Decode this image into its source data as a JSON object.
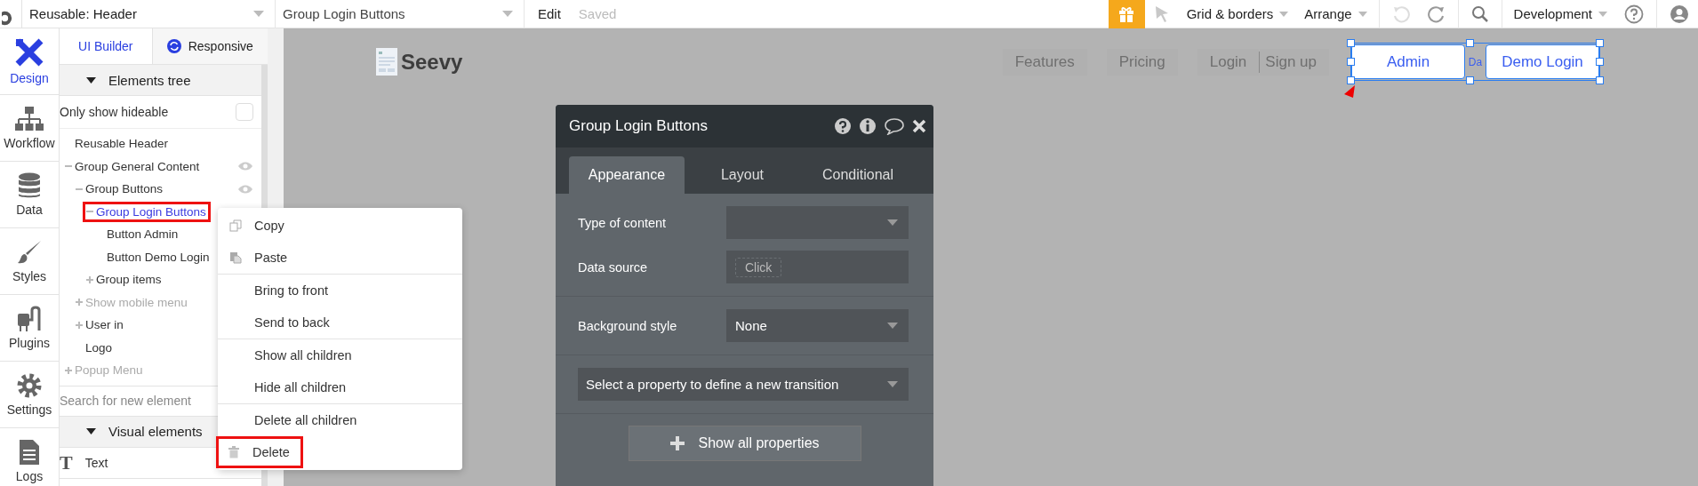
{
  "topbar": {
    "page_dropdown": "Reusable: Header",
    "element_dropdown": "Group Login Buttons",
    "edit": "Edit",
    "status": "Saved",
    "grid_menu": "Grid & borders",
    "arrange_menu": "Arrange",
    "environment": "Development"
  },
  "nav": [
    {
      "label": "Design",
      "selected": true
    },
    {
      "label": "Workflow",
      "selected": false
    },
    {
      "label": "Data",
      "selected": false
    },
    {
      "label": "Styles",
      "selected": false
    },
    {
      "label": "Plugins",
      "selected": false
    },
    {
      "label": "Settings",
      "selected": false
    },
    {
      "label": "Logs",
      "selected": false
    }
  ],
  "panel_tabs": [
    {
      "label": "UI Builder",
      "selected": true
    },
    {
      "label": "Responsive",
      "selected": false
    }
  ],
  "elements_tree": {
    "title": "Elements tree",
    "filter_label": "Only show hideable",
    "filter_checked": false,
    "items": [
      {
        "label": "Reusable Header",
        "hidden": false,
        "selected": false,
        "eye": false
      },
      {
        "label": "Group General Content",
        "expanded": true,
        "hidden": false,
        "selected": false,
        "eye": true,
        "children": [
          {
            "label": "Group Buttons",
            "expanded": true,
            "hidden": false,
            "selected": false,
            "eye": true,
            "children": [
              {
                "label": "Group Login Buttons",
                "expanded": true,
                "hidden": false,
                "selected": true,
                "children": [
                  {
                    "label": "Button Admin",
                    "hidden": false,
                    "selected": false
                  },
                  {
                    "label": "Button Demo Login",
                    "hidden": false,
                    "selected": false
                  }
                ]
              },
              {
                "label": "Group items",
                "expanded": false,
                "hidden": false,
                "selected": false
              }
            ]
          },
          {
            "label": "Show mobile menu",
            "expanded": false,
            "hidden": true,
            "selected": false
          },
          {
            "label": "User in",
            "expanded": false,
            "hidden": false,
            "selected": false
          },
          {
            "label": "Logo",
            "hidden": false,
            "selected": false
          }
        ]
      },
      {
        "label": "Popup Menu",
        "expanded": false,
        "hidden": true,
        "selected": false
      }
    ]
  },
  "search": {
    "placeholder": "Search for new element"
  },
  "visual_elements": {
    "title": "Visual elements",
    "items": [
      {
        "glyph": "T",
        "label": "Text"
      }
    ]
  },
  "canvas": {
    "logo": "Seevy",
    "nav_links": [
      "Features",
      "Pricing",
      "Login",
      "Sign up"
    ],
    "buttons": [
      {
        "label": "Admin"
      },
      {
        "label": "Demo Login"
      }
    ],
    "hidden_text": "Da"
  },
  "property_editor": {
    "title": "Group Login Buttons",
    "tabs": [
      {
        "label": "Appearance",
        "selected": true
      },
      {
        "label": "Layout",
        "selected": false
      },
      {
        "label": "Conditional",
        "selected": false
      }
    ],
    "sections": [
      [
        {
          "kind": "select",
          "label": "Type of content"
        },
        {
          "kind": "expression",
          "label": "Data source",
          "placeholder": "Click"
        }
      ],
      [
        {
          "kind": "select",
          "label": "Background style",
          "value": "None"
        }
      ],
      [
        {
          "kind": "wide_select",
          "value": "Select a property to define a new transition"
        }
      ]
    ],
    "button": "Show all properties"
  },
  "context_menu": [
    [
      {
        "label": "Copy",
        "highlighted": false
      },
      {
        "label": "Paste",
        "highlighted": false
      }
    ],
    [
      {
        "label": "Bring to front",
        "highlighted": false
      },
      {
        "label": "Send to back",
        "highlighted": false
      }
    ],
    [
      {
        "label": "Show all children",
        "highlighted": false
      },
      {
        "label": "Hide all children",
        "highlighted": false
      }
    ],
    [
      {
        "label": "Delete all children",
        "highlighted": false
      },
      {
        "label": "Delete",
        "highlighted": true
      }
    ]
  ]
}
